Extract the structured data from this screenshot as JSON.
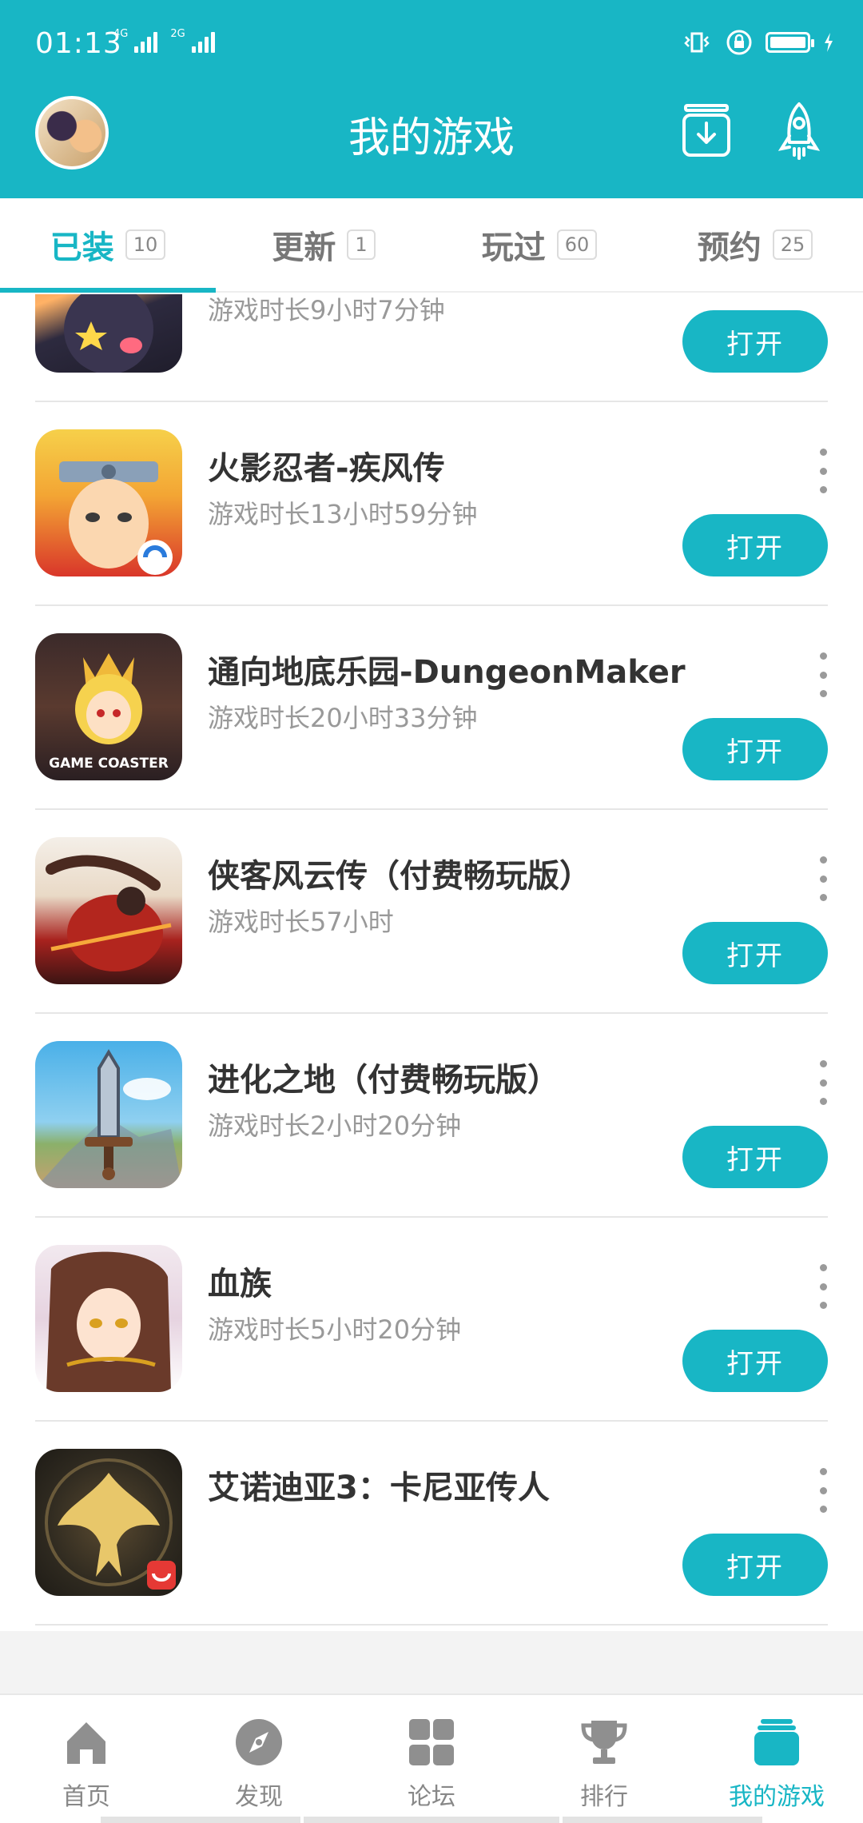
{
  "status_bar": {
    "time": "01:13",
    "network_1": "4G",
    "network_2": "2G"
  },
  "header": {
    "title": "我的游戏",
    "download_icon": "download-box-icon",
    "rocket_icon": "rocket-icon"
  },
  "tabs": [
    {
      "label": "已装",
      "count": "10",
      "active": true
    },
    {
      "label": "更新",
      "count": "1",
      "active": false
    },
    {
      "label": "玩过",
      "count": "60",
      "active": false
    },
    {
      "label": "预约",
      "count": "25",
      "active": false
    }
  ],
  "games": [
    {
      "title": "",
      "playtime": "游戏时长9小时7分钟",
      "button": "打开"
    },
    {
      "title": "火影忍者-疾风传",
      "playtime": "游戏时长13小时59分钟",
      "button": "打开"
    },
    {
      "title": "通向地底乐园-DungeonMaker",
      "playtime": "游戏时长20小时33分钟",
      "button": "打开",
      "icon_text": "GAME COASTER"
    },
    {
      "title": "侠客风云传（付费畅玩版）",
      "playtime": "游戏时长57小时",
      "button": "打开"
    },
    {
      "title": "进化之地（付费畅玩版）",
      "playtime": "游戏时长2小时20分钟",
      "button": "打开"
    },
    {
      "title": "血族",
      "playtime": "游戏时长5小时20分钟",
      "button": "打开"
    },
    {
      "title": "艾诺迪亚3：卡尼亚传人",
      "playtime": "",
      "button": "打开"
    }
  ],
  "bottom_nav": [
    {
      "label": "首页",
      "icon": "home-icon",
      "active": false
    },
    {
      "label": "发现",
      "icon": "compass-icon",
      "active": false
    },
    {
      "label": "论坛",
      "icon": "grid-icon",
      "active": false
    },
    {
      "label": "排行",
      "icon": "trophy-icon",
      "active": false
    },
    {
      "label": "我的游戏",
      "icon": "game-box-icon",
      "active": true
    }
  ],
  "colors": {
    "accent": "#18b6c5",
    "inactive_text": "#888888",
    "divider": "#e6e6e6"
  }
}
